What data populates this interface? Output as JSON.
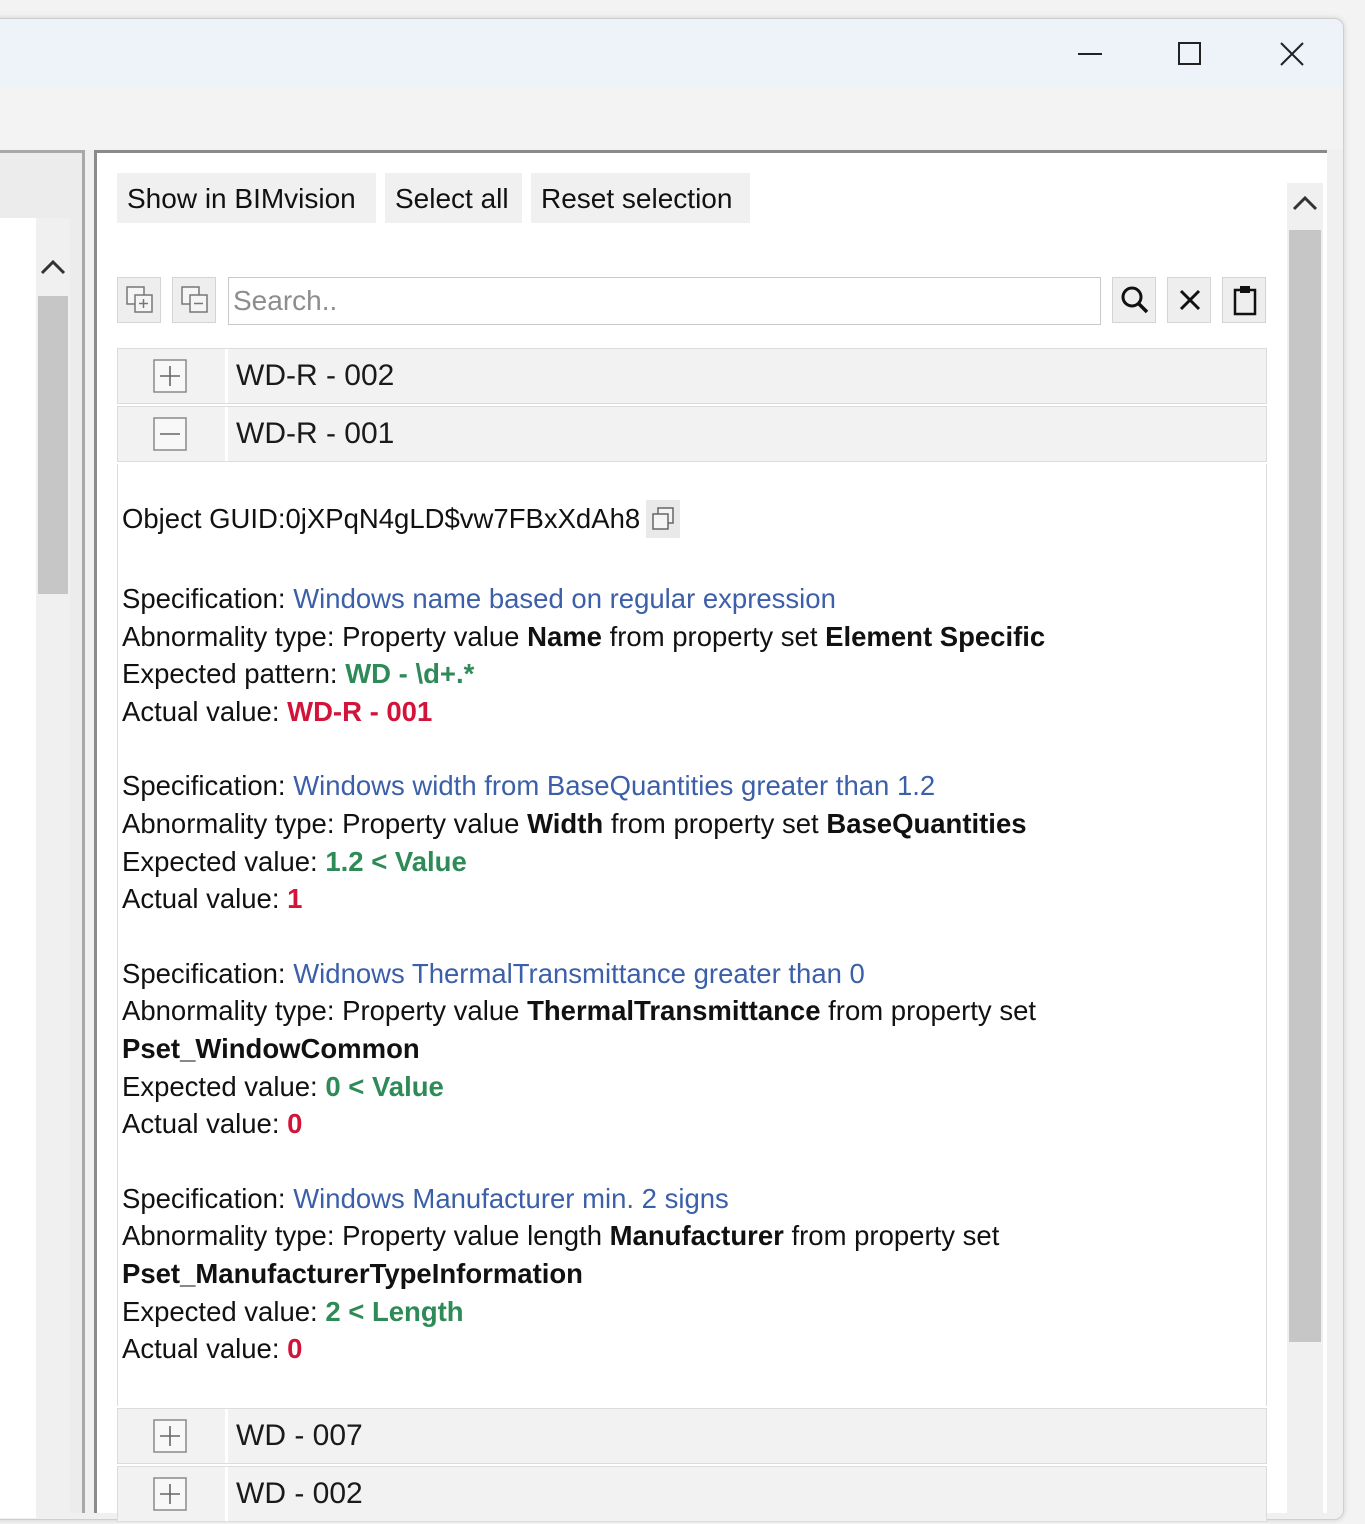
{
  "window": {
    "controls": [
      "minimize-icon",
      "maximize-icon",
      "close-icon"
    ]
  },
  "toolbar": {
    "show_label": "Show in BIMvision",
    "select_all_label": "Select all",
    "reset_label": "Reset selection"
  },
  "search": {
    "placeholder": "Search..",
    "value": "",
    "icons": [
      "expand-all-icon",
      "collapse-all-icon",
      "search-icon",
      "clear-icon",
      "clipboard-icon"
    ]
  },
  "tree": {
    "nodes": [
      {
        "label": "WD-R - 002",
        "expanded": false
      },
      {
        "label": "WD-R - 001",
        "expanded": true
      },
      {
        "label": "WD - 007",
        "expanded": false
      },
      {
        "label": "WD - 002",
        "expanded": false
      }
    ],
    "details": {
      "guid_label": "Object GUID: ",
      "guid_value": "0jXPqN4gLD$vw7FBxXdAh8",
      "specs": [
        {
          "spec_label": "Specification: ",
          "spec_name": "Windows name based on regular expression",
          "ab_label": "Abnormality type: ",
          "ab_pre": "Property value ",
          "ab_prop": "Name",
          "ab_mid": " from property set ",
          "ab_set": "Element Specific",
          "exp_label": "Expected pattern: ",
          "exp_value": "WD - \\d+.*",
          "act_label": "Actual value: ",
          "act_value": "WD-R - 001"
        },
        {
          "spec_label": "Specification: ",
          "spec_name": "Windows width from BaseQuantities greater than 1.2",
          "ab_label": "Abnormality type: ",
          "ab_pre": "Property value ",
          "ab_prop": "Width",
          "ab_mid": " from property set ",
          "ab_set": "BaseQuantities",
          "exp_label": "Expected value: ",
          "exp_value": "1.2 < Value",
          "act_label": "Actual value: ",
          "act_value": "1"
        },
        {
          "spec_label": "Specification: ",
          "spec_name": "Widnows ThermalTransmittance greater than 0",
          "ab_label": "Abnormality type: ",
          "ab_pre": "Property value ",
          "ab_prop": "ThermalTransmittance",
          "ab_mid": " from property set ",
          "ab_set": "Pset_WindowCommon",
          "exp_label": "Expected value: ",
          "exp_value": "0 < Value",
          "act_label": "Actual value: ",
          "act_value": "0"
        },
        {
          "spec_label": "Specification: ",
          "spec_name": "Windows Manufacturer min. 2 signs",
          "ab_label": "Abnormality type: ",
          "ab_pre": "Property value length ",
          "ab_prop": "Manufacturer",
          "ab_mid": " from property set ",
          "ab_set": "Pset_ManufacturerTypeInformation",
          "exp_label": "Expected value: ",
          "exp_value": "2 < Length",
          "act_label": "Actual value: ",
          "act_value": "0"
        }
      ]
    }
  },
  "colors": {
    "spec_link": "#3b5fa8",
    "expected": "#2e8b57",
    "actual": "#d2143a"
  }
}
